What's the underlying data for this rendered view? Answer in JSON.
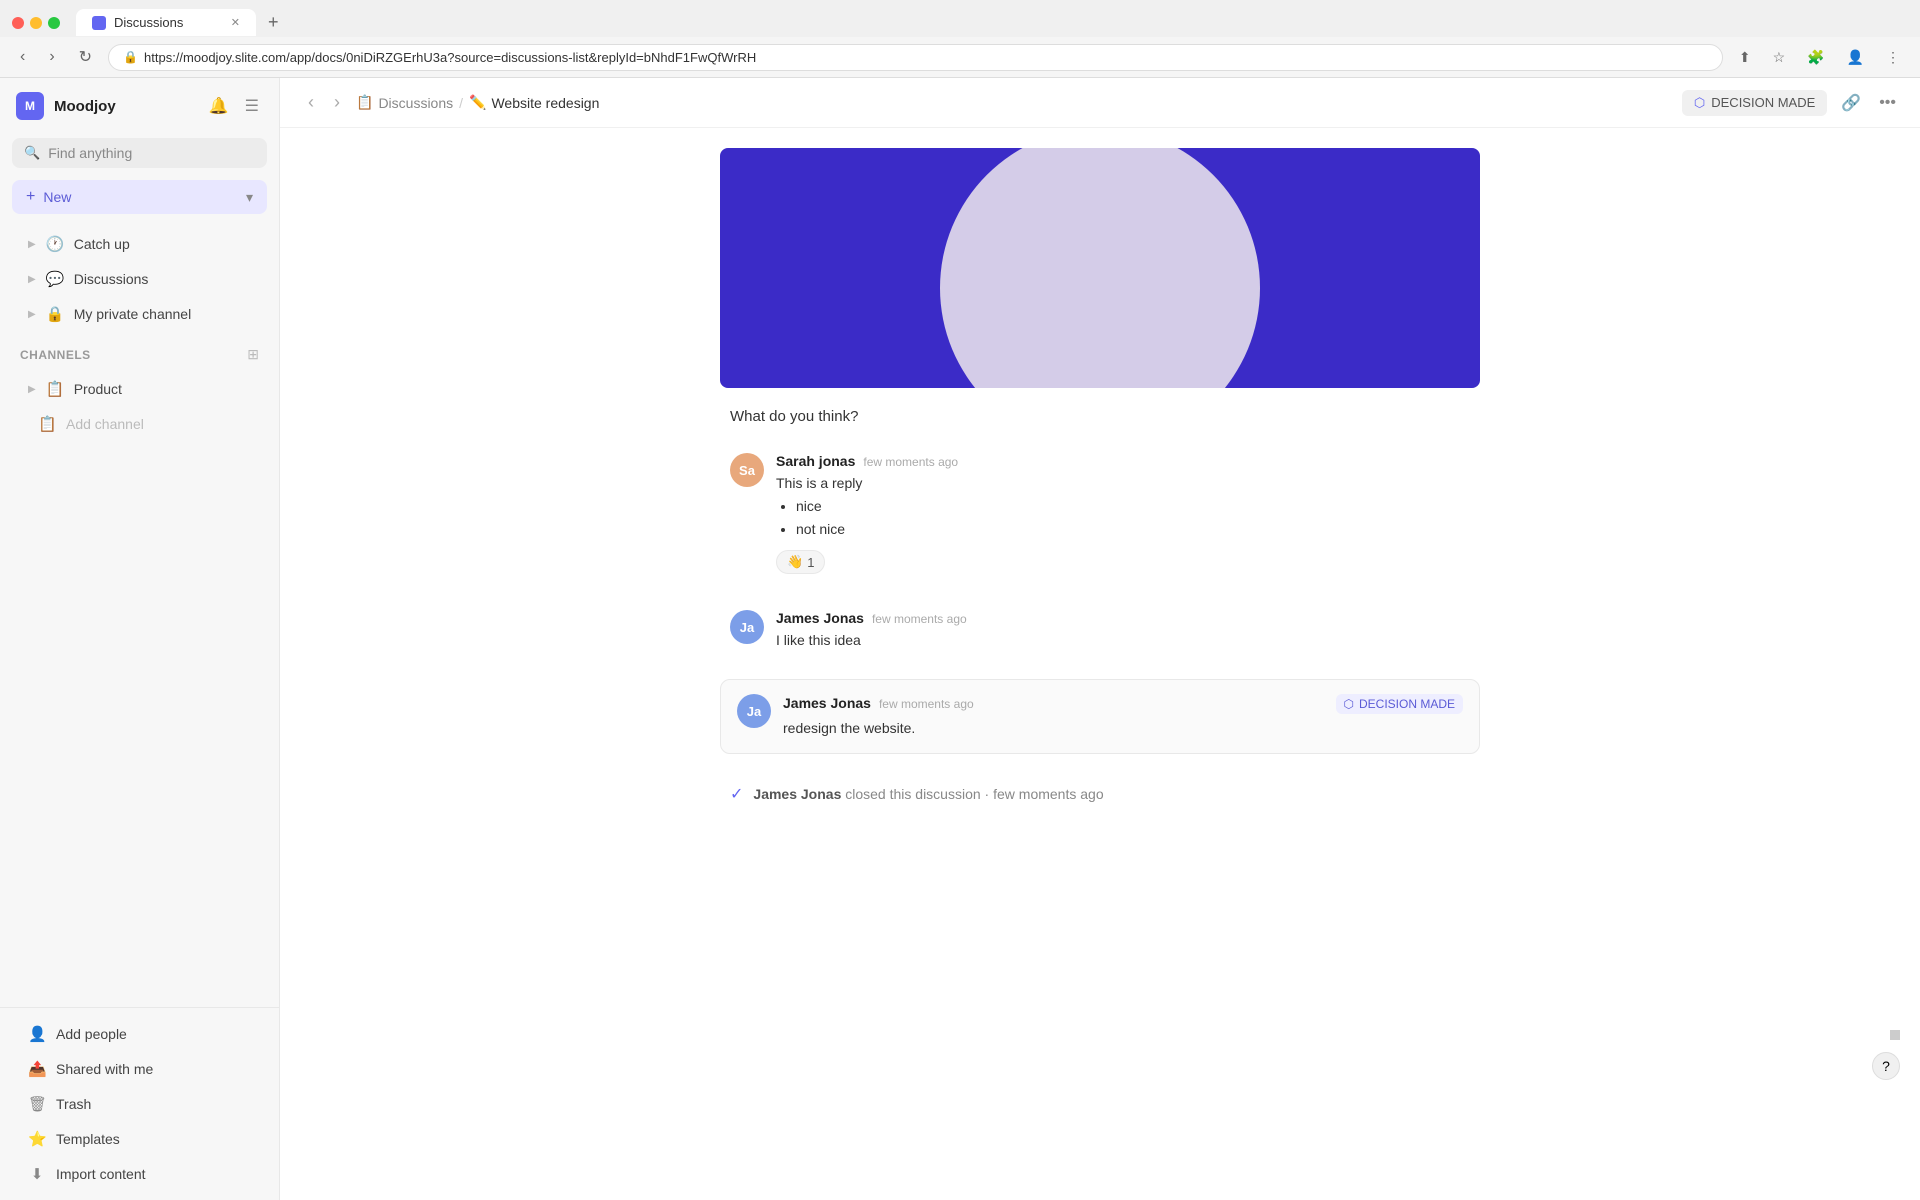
{
  "browser": {
    "tab_label": "Discussions",
    "url": "moodjoy.slite.com/app/docs/0niDiRZGErhU3a?source=discussions-list&replyId=bNhdF1FwQfWrRH",
    "url_full": "https://moodjoy.slite.com/app/docs/0niDiRZGErhU3a?source=discussions-list&replyId=bNhdF1FwQfWrRH"
  },
  "sidebar": {
    "app_name": "Moodjoy",
    "search_placeholder": "Find anything",
    "new_button_label": "New",
    "nav_items": [
      {
        "id": "catch-up",
        "label": "Catch up",
        "icon": "🕐"
      },
      {
        "id": "discussions",
        "label": "Discussions",
        "icon": "💬"
      },
      {
        "id": "my-private-channel",
        "label": "My private channel",
        "icon": "🔒"
      }
    ],
    "channels_label": "Channels",
    "channels": [
      {
        "id": "product",
        "label": "Product",
        "icon": "📋"
      }
    ],
    "add_channel_label": "Add channel",
    "bottom_items": [
      {
        "id": "add-people",
        "label": "Add people",
        "icon": "👤"
      },
      {
        "id": "shared-with-me",
        "label": "Shared with me",
        "icon": "📤"
      },
      {
        "id": "trash",
        "label": "Trash",
        "icon": "🗑"
      },
      {
        "id": "templates",
        "label": "Templates",
        "icon": "⭐"
      },
      {
        "id": "import-content",
        "label": "Import content",
        "icon": "⬇"
      }
    ]
  },
  "topbar": {
    "breadcrumb_parent": "Discussions",
    "breadcrumb_parent_icon": "📋",
    "breadcrumb_sep": "/",
    "breadcrumb_current": "Website redesign",
    "breadcrumb_current_icon": "✏️",
    "decision_badge": "DECISION MADE",
    "more_label": "..."
  },
  "content": {
    "what_do_you_think": "What do you think?",
    "messages": [
      {
        "id": "msg1",
        "avatar_initials": "Sa",
        "avatar_class": "avatar-sa",
        "author": "Sarah jonas",
        "time": "few moments ago",
        "text": "This is a reply",
        "bullets": [
          "nice",
          "not nice"
        ],
        "reaction_emoji": "👋",
        "reaction_count": "1"
      },
      {
        "id": "msg2",
        "avatar_initials": "Ja",
        "avatar_class": "avatar-ja",
        "author": "James Jonas",
        "time": "few moments ago",
        "text": "I like this idea",
        "has_hover_actions": true
      }
    ],
    "decision_message": {
      "avatar_initials": "Ja",
      "avatar_class": "avatar-ja",
      "author": "James Jonas",
      "time": "few moments ago",
      "badge_label": "DECISION MADE",
      "text": "redesign the website."
    },
    "closed_notice": {
      "author": "James Jonas",
      "action": "closed this discussion",
      "time": "few moments ago"
    },
    "hover_actions": {
      "emoji": "☺",
      "reply": "↩",
      "more": "•••"
    }
  }
}
